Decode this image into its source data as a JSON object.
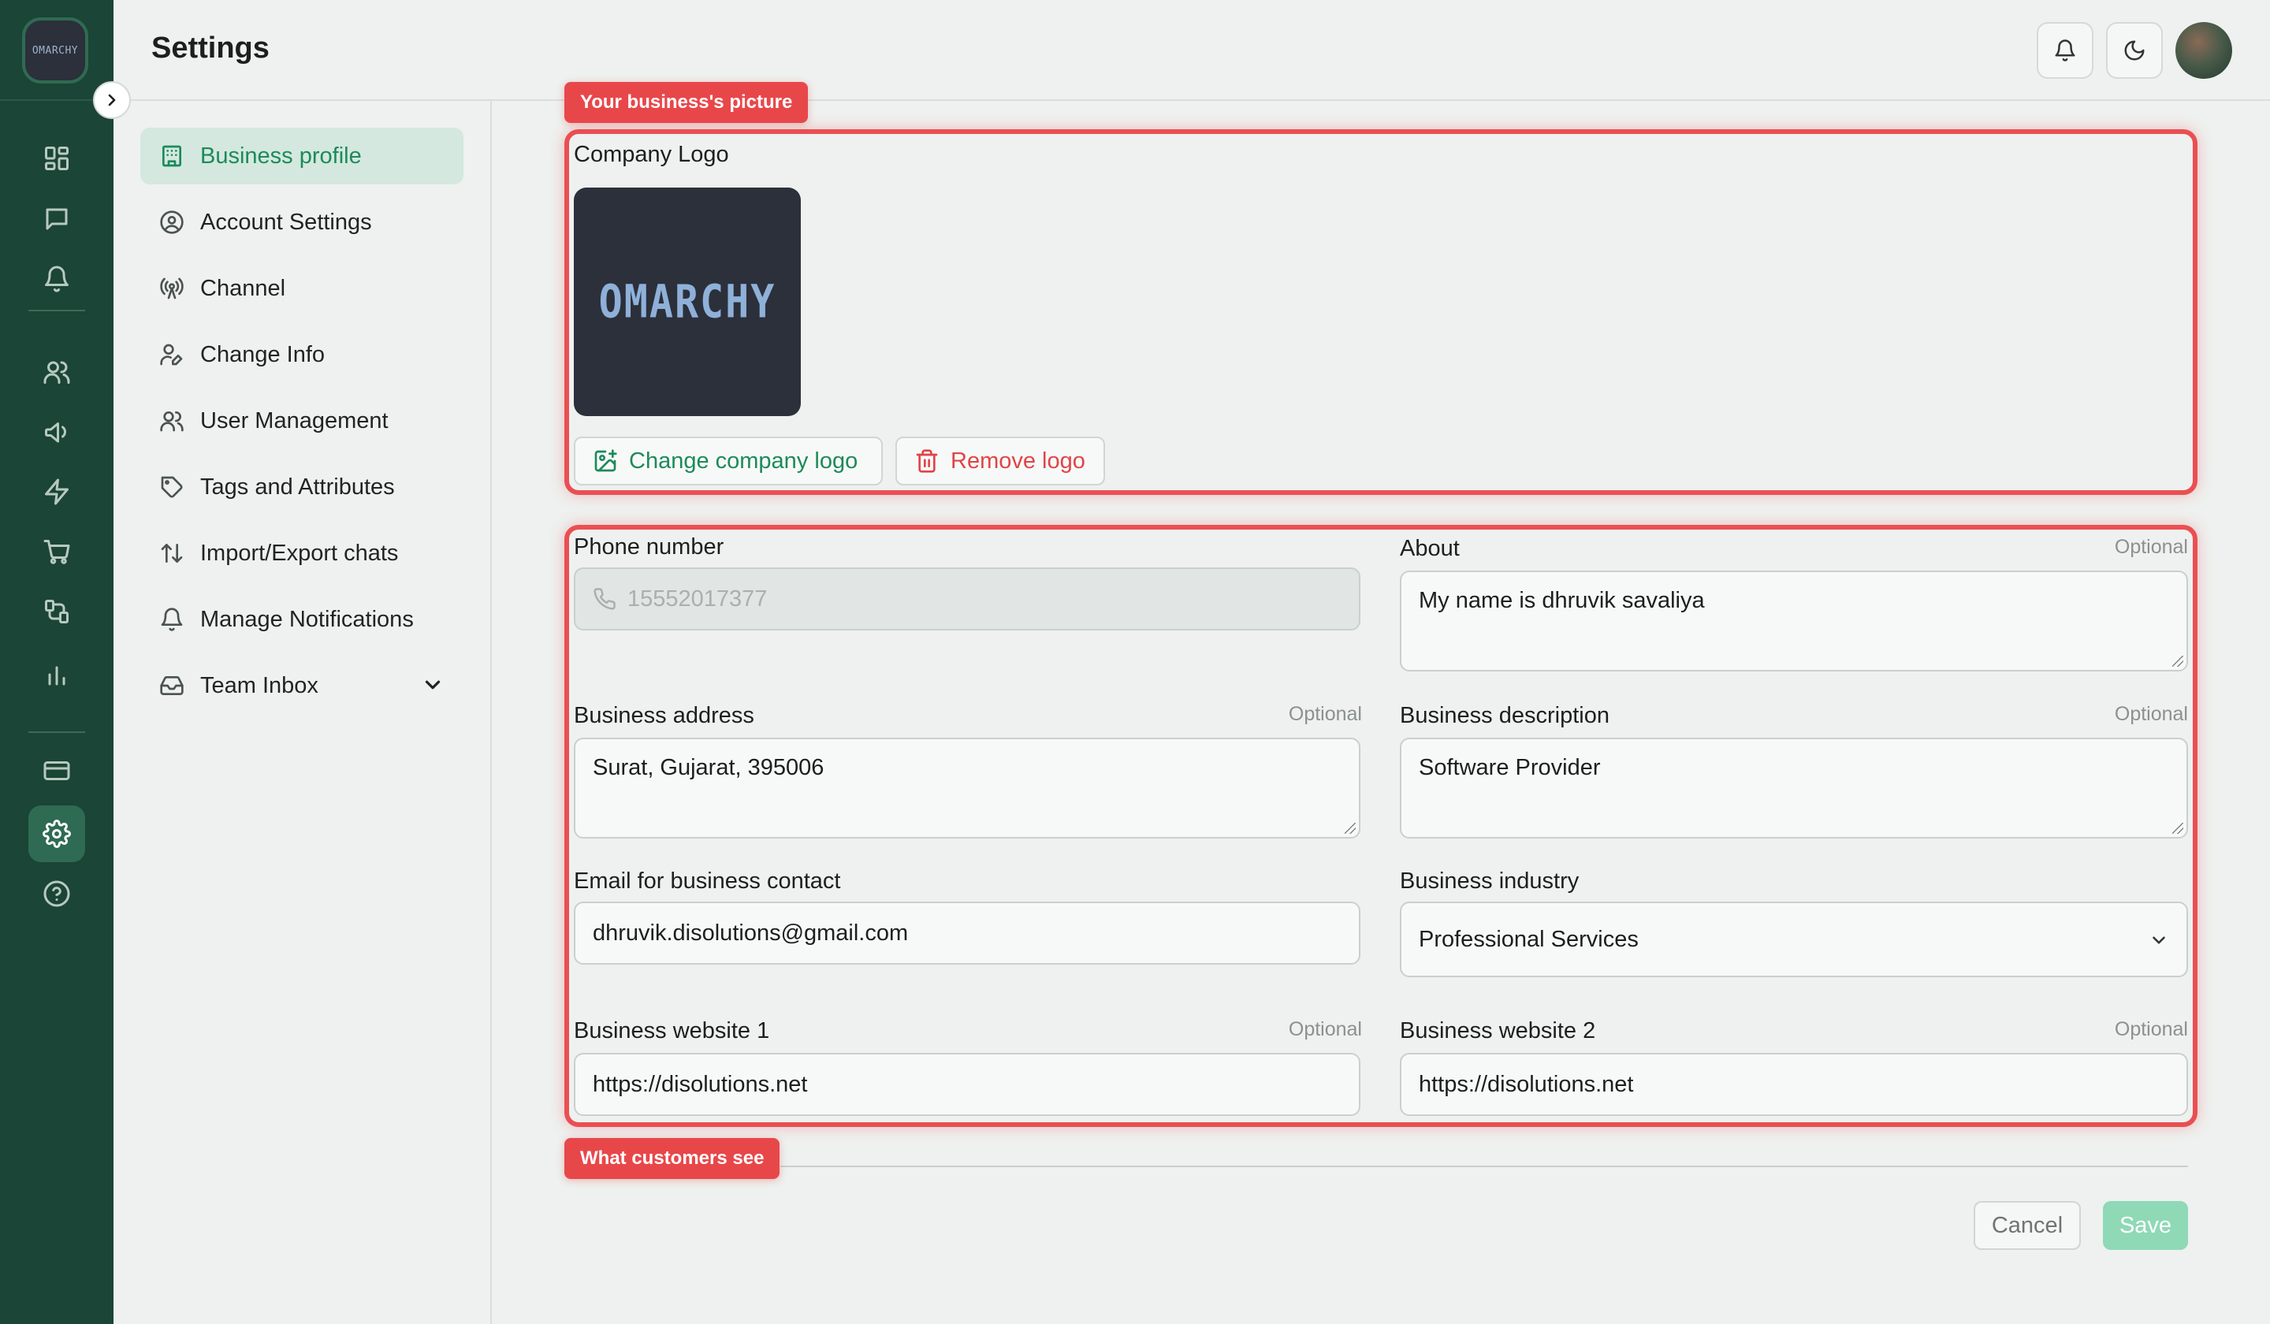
{
  "app": {
    "logo_text": "OMARCHY",
    "page_title": "Settings"
  },
  "rail": {
    "icons": [
      "dashboard-icon",
      "chat-icon",
      "bell-icon",
      "users-icon",
      "megaphone-icon",
      "lightning-icon",
      "cart-icon",
      "flow-icon",
      "bar-chart-icon",
      "card-icon",
      "settings-icon",
      "help-icon"
    ],
    "active": "settings-icon"
  },
  "header": {
    "buttons": [
      "bell-icon",
      "moon-icon"
    ]
  },
  "nav": {
    "items": [
      {
        "label": "Business profile",
        "icon": "building-icon",
        "active": true
      },
      {
        "label": "Account Settings",
        "icon": "user-circle-icon"
      },
      {
        "label": "Channel",
        "icon": "broadcast-icon"
      },
      {
        "label": "Change Info",
        "icon": "user-edit-icon"
      },
      {
        "label": "User Management",
        "icon": "users-icon"
      },
      {
        "label": "Tags and Attributes",
        "icon": "tag-icon"
      },
      {
        "label": "Import/Export chats",
        "icon": "sort-arrows-icon"
      },
      {
        "label": "Manage Notifications",
        "icon": "bell-icon"
      },
      {
        "label": "Team Inbox",
        "icon": "inbox-icon",
        "expandable": true
      }
    ]
  },
  "annotations": {
    "picture_tag": "Your business's picture",
    "customers_tag": "What customers see",
    "highlight_color": "#ea4f52"
  },
  "logo_section": {
    "label": "Company Logo",
    "logo_text": "OMARCHY",
    "change_label": "Change company logo",
    "remove_label": "Remove logo"
  },
  "form": {
    "optional_text": "Optional",
    "phone": {
      "label": "Phone number",
      "value": "15552017377"
    },
    "about": {
      "label": "About",
      "value": "My name is dhruvik savaliya"
    },
    "address": {
      "label": "Business address",
      "value": "Surat, Gujarat, 395006"
    },
    "description": {
      "label": "Business description",
      "value": "Software Provider"
    },
    "email": {
      "label": "Email for business contact",
      "value": "dhruvik.disolutions@gmail.com"
    },
    "industry": {
      "label": "Business industry",
      "value": "Professional Services"
    },
    "website1": {
      "label": "Business website 1",
      "value": "https://disolutions.net"
    },
    "website2": {
      "label": "Business website 2",
      "value": "https://disolutions.net"
    }
  },
  "footer": {
    "cancel_label": "Cancel",
    "save_label": "Save"
  },
  "colors": {
    "rail_bg": "#1b4536",
    "accent": "#1d8a5a",
    "danger": "#e04448",
    "save_disabled": "#8fd9b6"
  }
}
